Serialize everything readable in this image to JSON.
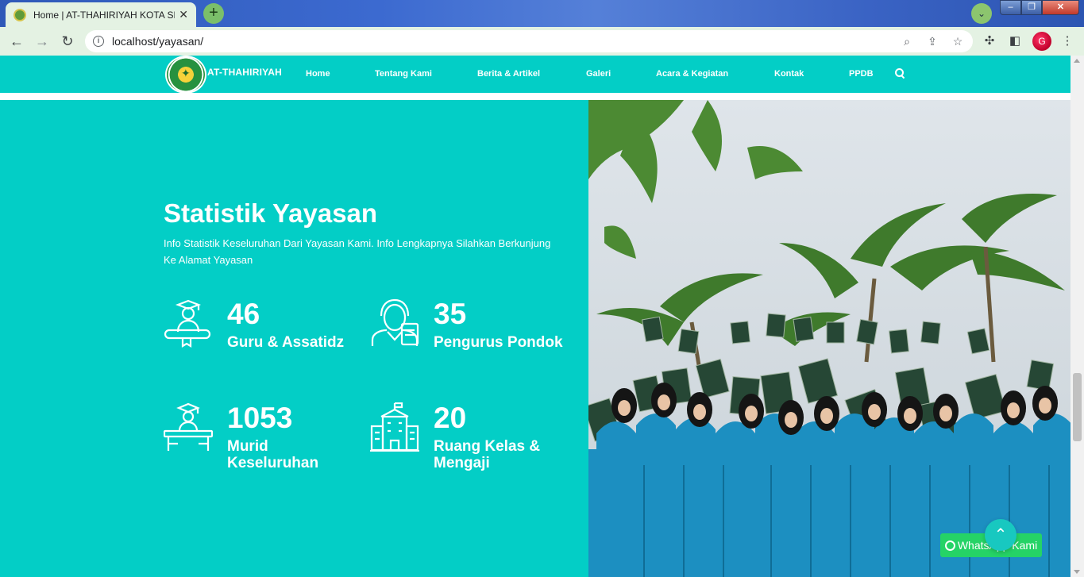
{
  "browser": {
    "tab_title": "Home | AT-THAHIRIYAH KOTA SE",
    "url": "localhost/yayasan/",
    "profile_initial": "G"
  },
  "site": {
    "brand": "AT-THAHIRIYAH",
    "nav_items": [
      "Home",
      "Tentang Kami",
      "Berita & Artikel",
      "Galeri",
      "Acara & Kegiatan",
      "Kontak",
      "PPDB"
    ]
  },
  "stats": {
    "title": "Statistik Yayasan",
    "description": "Info Statistik Keseluruhan Dari Yayasan Kami. Info Lengkapnya Silahkan Berkunjung Ke Alamat Yayasan",
    "items": [
      {
        "value": "46",
        "label": "Guru & Assatidz",
        "icon": "graduate-icon"
      },
      {
        "value": "35",
        "label": "Pengurus Pondok",
        "icon": "staff-icon"
      },
      {
        "value": "1053",
        "label": "Murid Keseluruhan",
        "icon": "student-desk-icon"
      },
      {
        "value": "20",
        "label": "Ruang Kelas & Mengaji",
        "icon": "school-building-icon"
      }
    ]
  },
  "widgets": {
    "whatsapp_label": "WhatsApp Kami",
    "back_to_top_icon": "chevron-up-icon"
  },
  "colors": {
    "brand_teal": "#03cec6",
    "whatsapp_green": "#25d366"
  }
}
